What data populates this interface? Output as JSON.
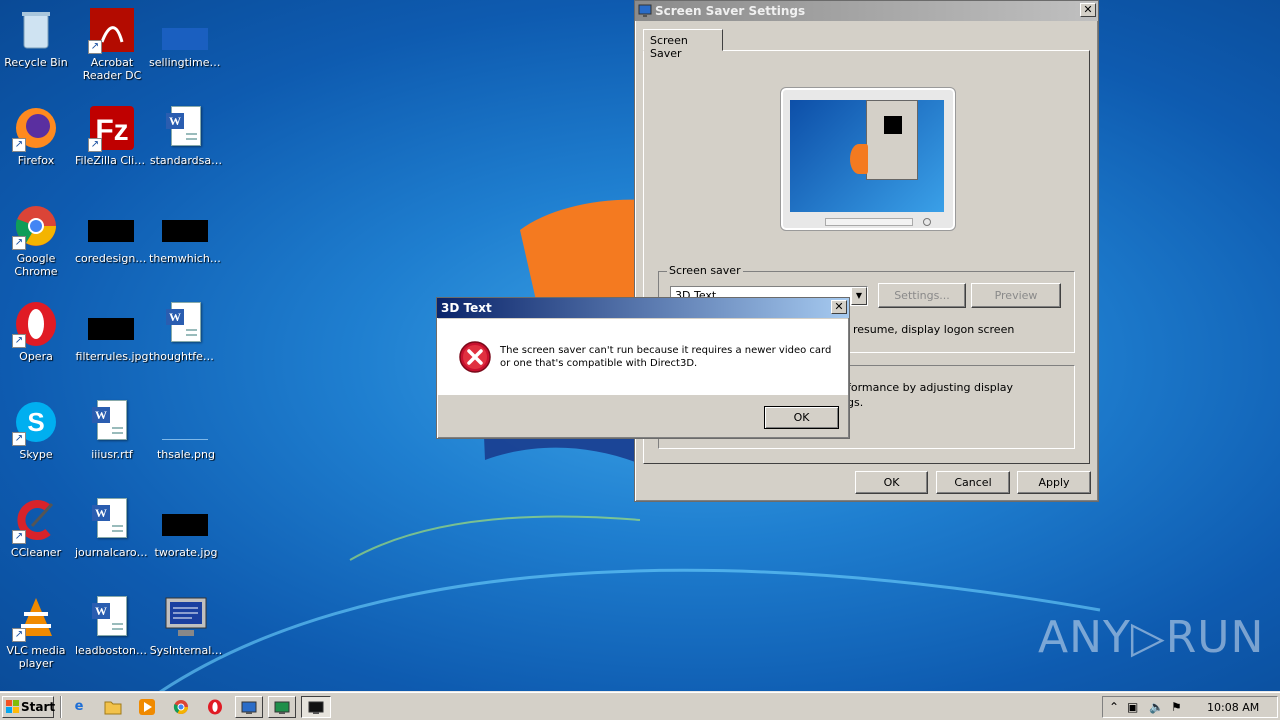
{
  "desktop": {
    "icons": [
      {
        "label": "Recycle Bin",
        "icon": "recycle-bin-icon"
      },
      {
        "label": "Acrobat Reader DC",
        "icon": "acrobat-icon"
      },
      {
        "label": "sellingtimes.…",
        "icon": "file-icon"
      },
      {
        "label": "Firefox",
        "icon": "firefox-icon"
      },
      {
        "label": "FileZilla Client",
        "icon": "filezilla-icon"
      },
      {
        "label": "standardsa…",
        "icon": "word-doc-icon"
      },
      {
        "label": "Google Chrome",
        "icon": "chrome-icon"
      },
      {
        "label": "coredesign.jpg",
        "icon": "image-icon"
      },
      {
        "label": "themwhich.jpg",
        "icon": "image-icon"
      },
      {
        "label": "Opera",
        "icon": "opera-icon"
      },
      {
        "label": "filterrules.jpg",
        "icon": "image-icon"
      },
      {
        "label": "thoughtfem…",
        "icon": "word-doc-icon"
      },
      {
        "label": "Skype",
        "icon": "skype-icon"
      },
      {
        "label": "iiiusr.rtf",
        "icon": "word-doc-icon"
      },
      {
        "label": "thsale.png",
        "icon": "image-icon"
      },
      {
        "label": "CCleaner",
        "icon": "ccleaner-icon"
      },
      {
        "label": "journalcaroli…",
        "icon": "word-doc-icon"
      },
      {
        "label": "tworate.jpg",
        "icon": "image-icon"
      },
      {
        "label": "VLC media player",
        "icon": "vlc-icon"
      },
      {
        "label": "leadboston.rtf",
        "icon": "word-doc-icon"
      },
      {
        "label": "SysInternal…",
        "icon": "sysinternals-icon"
      }
    ],
    "watermark": "ANY▷RUN"
  },
  "screensaver_dialog": {
    "title": "Screen Saver Settings",
    "tab": "Screen Saver",
    "group_screensaver": "Screen saver",
    "selected_saver": "3D Text",
    "settings_btn": "Settings...",
    "preview_btn": "Preview",
    "resume_text": "resume, display logon screen",
    "power_text_1": "formance by adjusting display",
    "power_text_2": "gs.",
    "ok": "OK",
    "cancel": "Cancel",
    "apply": "Apply"
  },
  "error_dialog": {
    "title": "3D Text",
    "message_1": "The screen saver can't run because it requires a newer video card",
    "message_2": "or one that's compatible with Direct3D.",
    "ok": "OK"
  },
  "taskbar": {
    "start": "Start",
    "clock": "10:08 AM"
  }
}
